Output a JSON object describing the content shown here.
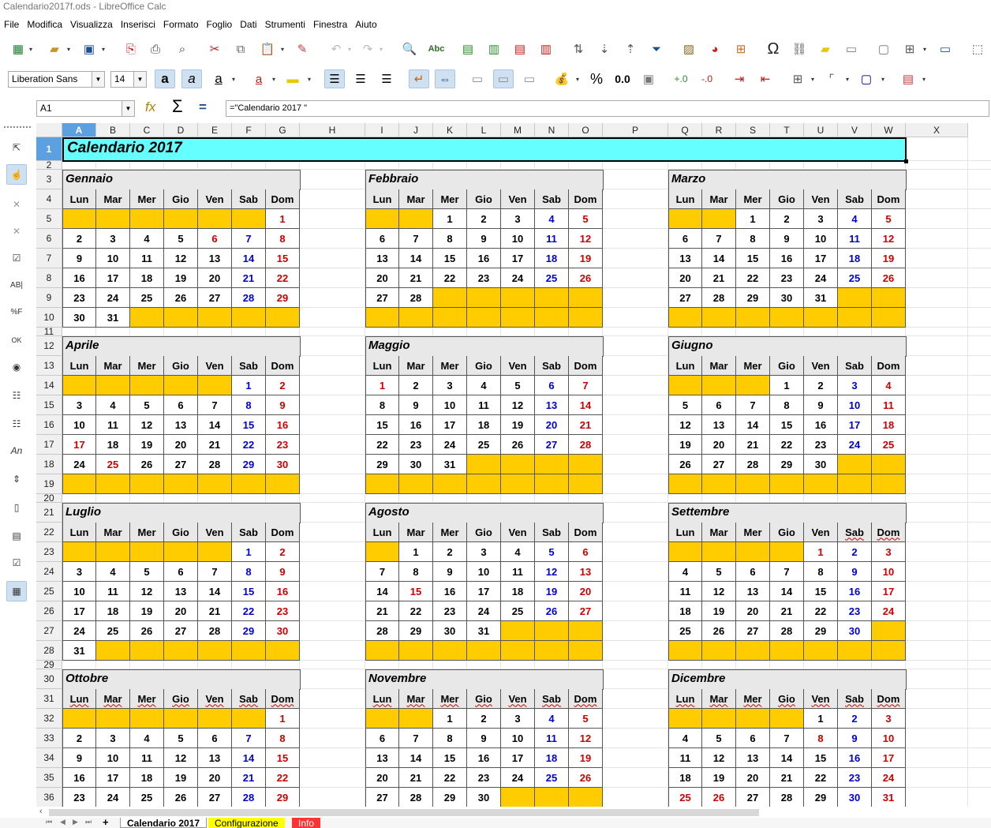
{
  "window": {
    "title": "Calendario2017f.ods - LibreOffice Calc"
  },
  "menu": [
    "File",
    "Modifica",
    "Visualizza",
    "Inserisci",
    "Formato",
    "Foglio",
    "Dati",
    "Strumenti",
    "Finestra",
    "Aiuto"
  ],
  "format_toolbar": {
    "font_name": "Liberation Sans",
    "font_size": "14"
  },
  "formula_bar": {
    "cell_ref": "A1",
    "formula": "=\"Calendario 2017 \""
  },
  "columns": [
    "A",
    "B",
    "C",
    "D",
    "E",
    "F",
    "G",
    "H",
    "I",
    "J",
    "K",
    "L",
    "M",
    "N",
    "O",
    "P",
    "Q",
    "R",
    "S",
    "T",
    "U",
    "V",
    "W",
    "X"
  ],
  "rows": [
    "1",
    "2",
    "3",
    "4",
    "5",
    "6",
    "7",
    "8",
    "9",
    "10",
    "11",
    "12",
    "13",
    "14",
    "15",
    "16",
    "17",
    "18",
    "19",
    "20",
    "21",
    "22",
    "23",
    "24",
    "25",
    "26",
    "27",
    "28",
    "29",
    "30",
    "31",
    "32",
    "33",
    "34",
    "35",
    "36"
  ],
  "sheet_title": "Calendario 2017",
  "weekdays": [
    "Lun",
    "Mar",
    "Mer",
    "Gio",
    "Ven",
    "Sab",
    "Dom"
  ],
  "months": [
    {
      "name": "Gennaio",
      "weeks": [
        [
          "",
          "",
          "",
          "",
          "",
          "",
          "1"
        ],
        [
          "2",
          "3",
          "4",
          "5",
          "6",
          "7",
          "8"
        ],
        [
          "9",
          "10",
          "11",
          "12",
          "13",
          "14",
          "15"
        ],
        [
          "16",
          "17",
          "18",
          "19",
          "20",
          "21",
          "22"
        ],
        [
          "23",
          "24",
          "25",
          "26",
          "27",
          "28",
          "29"
        ],
        [
          "30",
          "31",
          "",
          "",
          "",
          "",
          ""
        ]
      ],
      "holidays": [
        [
          1,
          4
        ]
      ]
    },
    {
      "name": "Febbraio",
      "weeks": [
        [
          "",
          "",
          "1",
          "2",
          "3",
          "4",
          "5"
        ],
        [
          "6",
          "7",
          "8",
          "9",
          "10",
          "11",
          "12"
        ],
        [
          "13",
          "14",
          "15",
          "16",
          "17",
          "18",
          "19"
        ],
        [
          "20",
          "21",
          "22",
          "23",
          "24",
          "25",
          "26"
        ],
        [
          "27",
          "28",
          "",
          "",
          "",
          "",
          ""
        ],
        [
          "",
          "",
          "",
          "",
          "",
          "",
          ""
        ]
      ],
      "holidays": []
    },
    {
      "name": "Marzo",
      "weeks": [
        [
          "",
          "",
          "1",
          "2",
          "3",
          "4",
          "5"
        ],
        [
          "6",
          "7",
          "8",
          "9",
          "10",
          "11",
          "12"
        ],
        [
          "13",
          "14",
          "15",
          "16",
          "17",
          "18",
          "19"
        ],
        [
          "20",
          "21",
          "22",
          "23",
          "24",
          "25",
          "26"
        ],
        [
          "27",
          "28",
          "29",
          "30",
          "31",
          "",
          ""
        ],
        [
          "",
          "",
          "",
          "",
          "",
          "",
          ""
        ]
      ],
      "holidays": []
    },
    {
      "name": "Aprile",
      "weeks": [
        [
          "",
          "",
          "",
          "",
          "",
          "1",
          "2"
        ],
        [
          "3",
          "4",
          "5",
          "6",
          "7",
          "8",
          "9"
        ],
        [
          "10",
          "11",
          "12",
          "13",
          "14",
          "15",
          "16"
        ],
        [
          "17",
          "18",
          "19",
          "20",
          "21",
          "22",
          "23"
        ],
        [
          "24",
          "25",
          "26",
          "27",
          "28",
          "29",
          "30"
        ],
        [
          "",
          "",
          "",
          "",
          "",
          "",
          ""
        ]
      ],
      "holidays": [
        [
          3,
          0
        ],
        [
          4,
          1
        ]
      ]
    },
    {
      "name": "Maggio",
      "weeks": [
        [
          "1",
          "2",
          "3",
          "4",
          "5",
          "6",
          "7"
        ],
        [
          "8",
          "9",
          "10",
          "11",
          "12",
          "13",
          "14"
        ],
        [
          "15",
          "16",
          "17",
          "18",
          "19",
          "20",
          "21"
        ],
        [
          "22",
          "23",
          "24",
          "25",
          "26",
          "27",
          "28"
        ],
        [
          "29",
          "30",
          "31",
          "",
          "",
          "",
          ""
        ],
        [
          "",
          "",
          "",
          "",
          "",
          "",
          ""
        ]
      ],
      "holidays": [
        [
          0,
          0
        ]
      ]
    },
    {
      "name": "Giugno",
      "weeks": [
        [
          "",
          "",
          "",
          "1",
          "2",
          "3",
          "4"
        ],
        [
          "5",
          "6",
          "7",
          "8",
          "9",
          "10",
          "11"
        ],
        [
          "12",
          "13",
          "14",
          "15",
          "16",
          "17",
          "18"
        ],
        [
          "19",
          "20",
          "21",
          "22",
          "23",
          "24",
          "25"
        ],
        [
          "26",
          "27",
          "28",
          "29",
          "30",
          "",
          ""
        ],
        [
          "",
          "",
          "",
          "",
          "",
          "",
          ""
        ]
      ],
      "holidays": []
    },
    {
      "name": "Luglio",
      "weeks": [
        [
          "",
          "",
          "",
          "",
          "",
          "1",
          "2"
        ],
        [
          "3",
          "4",
          "5",
          "6",
          "7",
          "8",
          "9"
        ],
        [
          "10",
          "11",
          "12",
          "13",
          "14",
          "15",
          "16"
        ],
        [
          "17",
          "18",
          "19",
          "20",
          "21",
          "22",
          "23"
        ],
        [
          "24",
          "25",
          "26",
          "27",
          "28",
          "29",
          "30"
        ],
        [
          "31",
          "",
          "",
          "",
          "",
          "",
          ""
        ]
      ],
      "holidays": []
    },
    {
      "name": "Agosto",
      "weeks": [
        [
          "",
          "1",
          "2",
          "3",
          "4",
          "5",
          "6"
        ],
        [
          "7",
          "8",
          "9",
          "10",
          "11",
          "12",
          "13"
        ],
        [
          "14",
          "15",
          "16",
          "17",
          "18",
          "19",
          "20"
        ],
        [
          "21",
          "22",
          "23",
          "24",
          "25",
          "26",
          "27"
        ],
        [
          "28",
          "29",
          "30",
          "31",
          "",
          "",
          ""
        ],
        [
          "",
          "",
          "",
          "",
          "",
          "",
          ""
        ]
      ],
      "holidays": [
        [
          2,
          1
        ]
      ]
    },
    {
      "name": "Settembre",
      "weeks": [
        [
          "",
          "",
          "",
          "",
          "1",
          "2",
          "3"
        ],
        [
          "4",
          "5",
          "6",
          "7",
          "8",
          "9",
          "10"
        ],
        [
          "11",
          "12",
          "13",
          "14",
          "15",
          "16",
          "17"
        ],
        [
          "18",
          "19",
          "20",
          "21",
          "22",
          "23",
          "24"
        ],
        [
          "25",
          "26",
          "27",
          "28",
          "29",
          "30",
          ""
        ],
        [
          "",
          "",
          "",
          "",
          "",
          "",
          ""
        ]
      ],
      "holidays": [
        [
          0,
          4
        ]
      ]
    },
    {
      "name": "Ottobre",
      "weeks": [
        [
          "",
          "",
          "",
          "",
          "",
          "",
          "1"
        ],
        [
          "2",
          "3",
          "4",
          "5",
          "6",
          "7",
          "8"
        ],
        [
          "9",
          "10",
          "11",
          "12",
          "13",
          "14",
          "15"
        ],
        [
          "16",
          "17",
          "18",
          "19",
          "20",
          "21",
          "22"
        ],
        [
          "23",
          "24",
          "25",
          "26",
          "27",
          "28",
          "29"
        ]
      ],
      "holidays": []
    },
    {
      "name": "Novembre",
      "weeks": [
        [
          "",
          "",
          "1",
          "2",
          "3",
          "4",
          "5"
        ],
        [
          "6",
          "7",
          "8",
          "9",
          "10",
          "11",
          "12"
        ],
        [
          "13",
          "14",
          "15",
          "16",
          "17",
          "18",
          "19"
        ],
        [
          "20",
          "21",
          "22",
          "23",
          "24",
          "25",
          "26"
        ],
        [
          "27",
          "28",
          "29",
          "30",
          "",
          "",
          ""
        ]
      ],
      "holidays": []
    },
    {
      "name": "Dicembre",
      "weeks": [
        [
          "",
          "",
          "",
          "",
          "1",
          "2",
          "3"
        ],
        [
          "4",
          "5",
          "6",
          "7",
          "8",
          "9",
          "10"
        ],
        [
          "11",
          "12",
          "13",
          "14",
          "15",
          "16",
          "17"
        ],
        [
          "18",
          "19",
          "20",
          "21",
          "22",
          "23",
          "24"
        ],
        [
          "25",
          "26",
          "27",
          "28",
          "29",
          "30",
          "31"
        ]
      ],
      "holidays": [
        [
          1,
          4
        ],
        [
          4,
          0
        ],
        [
          4,
          1
        ]
      ]
    }
  ],
  "sheet_tabs": [
    "Calendario 2017",
    "Configurazione",
    "Info"
  ],
  "colors": {
    "title_bg": "#66ffff",
    "empty_cell": "#ffcc00",
    "header_bg": "#e8e8e8",
    "saturday": "#0000cc",
    "sunday_holiday": "#cc0000",
    "sheet_tab_config": "#ffff00",
    "sheet_tab_info": "#ff3333"
  }
}
